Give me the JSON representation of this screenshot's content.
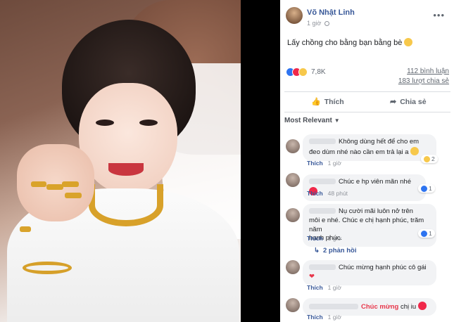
{
  "post": {
    "author": "Võ Nhật Linh",
    "time": "1 giờ",
    "caption": "Lấy chồng cho bằng bạn bằng bè",
    "reaction_count": "7,8K",
    "comments": "112 bình luận",
    "shares": "183 lượt chia sẻ",
    "like_label": "Thích",
    "share_label": "Chia sẻ",
    "sort_label": "Most Relevant"
  },
  "comments": [
    {
      "text_line1": "Không dùng hết để cho em",
      "text_line2": "đeo dùm nhé nào cần em trả lại a",
      "like": "Thích",
      "time": "1 giờ",
      "reactions": "2"
    },
    {
      "text": "Chúc e hp viên mãn nhé",
      "like": "Thích",
      "time": "48 phút",
      "reactions": "1"
    },
    {
      "text_line1": "Nụ cười mãi luôn nở trên",
      "text_line2": "môi e nhé. Chúc e chị hạnh phúc, trăm năm",
      "text_line3": "hạnh phúc.",
      "like": "Thích",
      "time": "1 giờ",
      "reactions": "1",
      "replies": "2 phản hồi"
    },
    {
      "text": "Chúc mừng hạnh phúc cô gái",
      "like": "Thích",
      "time": "1 giờ"
    },
    {
      "text_highlight": "Chúc mừng",
      "text_rest": "chị iu",
      "like": "Thích",
      "time": "1 giờ"
    }
  ],
  "colors": {
    "link": "#385898",
    "like_blue": "#2e74f0",
    "love_red": "#f0284a",
    "haha_yellow": "#f7c84b"
  }
}
